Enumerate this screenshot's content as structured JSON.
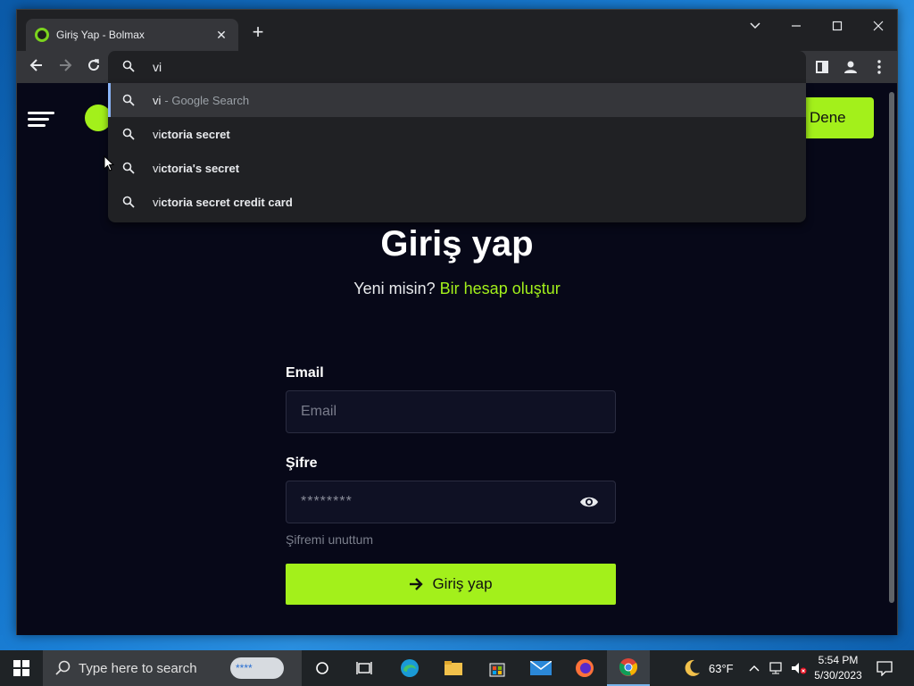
{
  "browser": {
    "tab_title": "Giriş Yap - Bolmax",
    "tab_close": "✕",
    "new_tab": "+",
    "omnibox_value": "vi",
    "suggestions": [
      {
        "typed": "vi",
        "completion": "",
        "suffix": "- Google Search"
      },
      {
        "typed": "vi",
        "completion": "ctoria secret",
        "suffix": ""
      },
      {
        "typed": "vi",
        "completion": "ctoria's secret",
        "suffix": ""
      },
      {
        "typed": "vi",
        "completion": "ctoria secret credit card",
        "suffix": ""
      }
    ]
  },
  "site": {
    "try_button": "Dene",
    "title": "Giriş yap",
    "subtitle_prefix": "Yeni misin?",
    "subtitle_link": "Bir hesap oluştur",
    "email_label": "Email",
    "email_placeholder": "Email",
    "password_label": "Şifre",
    "password_value": "********",
    "forgot_link": "Şifremi unuttum",
    "login_button": "Giriş yap",
    "accent_color": "#a3f01b"
  },
  "taskbar": {
    "search_placeholder": "Type here to search",
    "search_art_text": "****",
    "weather_temp": "63°F",
    "time": "5:54 PM",
    "date": "5/30/2023"
  }
}
